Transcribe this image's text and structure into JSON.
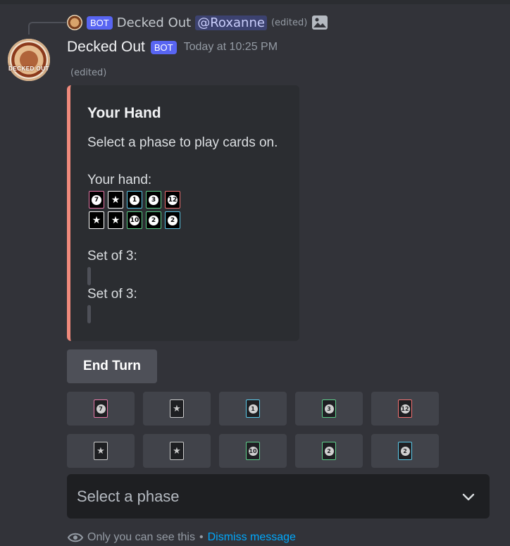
{
  "reply": {
    "author": "Decked Out",
    "bot_tag": "BOT",
    "mention": "@Roxanne",
    "edited": "(edited)"
  },
  "message": {
    "author": "Decked Out",
    "bot_tag": "BOT",
    "timestamp": "Today at 10:25 PM",
    "edited": "(edited)",
    "avatar_text": "DECKED OUT"
  },
  "embed": {
    "accent_color": "#f08a7c",
    "title": "Your Hand",
    "description": "Select a phase to play cards on.",
    "hand_label": "Your hand:",
    "hand": [
      {
        "value": "7",
        "kind": "number",
        "color": "#e879a9"
      },
      {
        "value": "★",
        "kind": "wild",
        "color": "#ffffff"
      },
      {
        "value": "1",
        "kind": "number",
        "color": "#5bc8e8"
      },
      {
        "value": "3",
        "kind": "number",
        "color": "#5ecf8a"
      },
      {
        "value": "12",
        "kind": "number",
        "color": "#f07070"
      },
      {
        "value": "★",
        "kind": "wild",
        "color": "#ffffff"
      },
      {
        "value": "★",
        "kind": "wild",
        "color": "#ffffff"
      },
      {
        "value": "10",
        "kind": "number",
        "color": "#5ecf8a"
      },
      {
        "value": "2",
        "kind": "number",
        "color": "#5ecf8a"
      },
      {
        "value": "2",
        "kind": "number",
        "color": "#5bc8e8"
      }
    ],
    "sets": [
      {
        "label": "Set of 3:"
      },
      {
        "label": "Set of 3:"
      }
    ]
  },
  "buttons": {
    "end_turn": "End Turn",
    "card_rows": [
      [
        {
          "value": "7",
          "kind": "number",
          "color": "#e879a9"
        },
        {
          "value": "★",
          "kind": "wild",
          "color": "#cccccc"
        },
        {
          "value": "1",
          "kind": "number",
          "color": "#5bc8e8"
        },
        {
          "value": "3",
          "kind": "number",
          "color": "#5ecf8a"
        },
        {
          "value": "12",
          "kind": "number",
          "color": "#f07070"
        }
      ],
      [
        {
          "value": "★",
          "kind": "wild",
          "color": "#cccccc"
        },
        {
          "value": "★",
          "kind": "wild",
          "color": "#cccccc"
        },
        {
          "value": "10",
          "kind": "number",
          "color": "#5ecf8a"
        },
        {
          "value": "2",
          "kind": "number",
          "color": "#5ecf8a"
        },
        {
          "value": "2",
          "kind": "number",
          "color": "#5bc8e8"
        }
      ]
    ]
  },
  "select": {
    "placeholder": "Select a phase"
  },
  "footer": {
    "notice": "Only you can see this",
    "separator": "•",
    "dismiss": "Dismiss message"
  }
}
